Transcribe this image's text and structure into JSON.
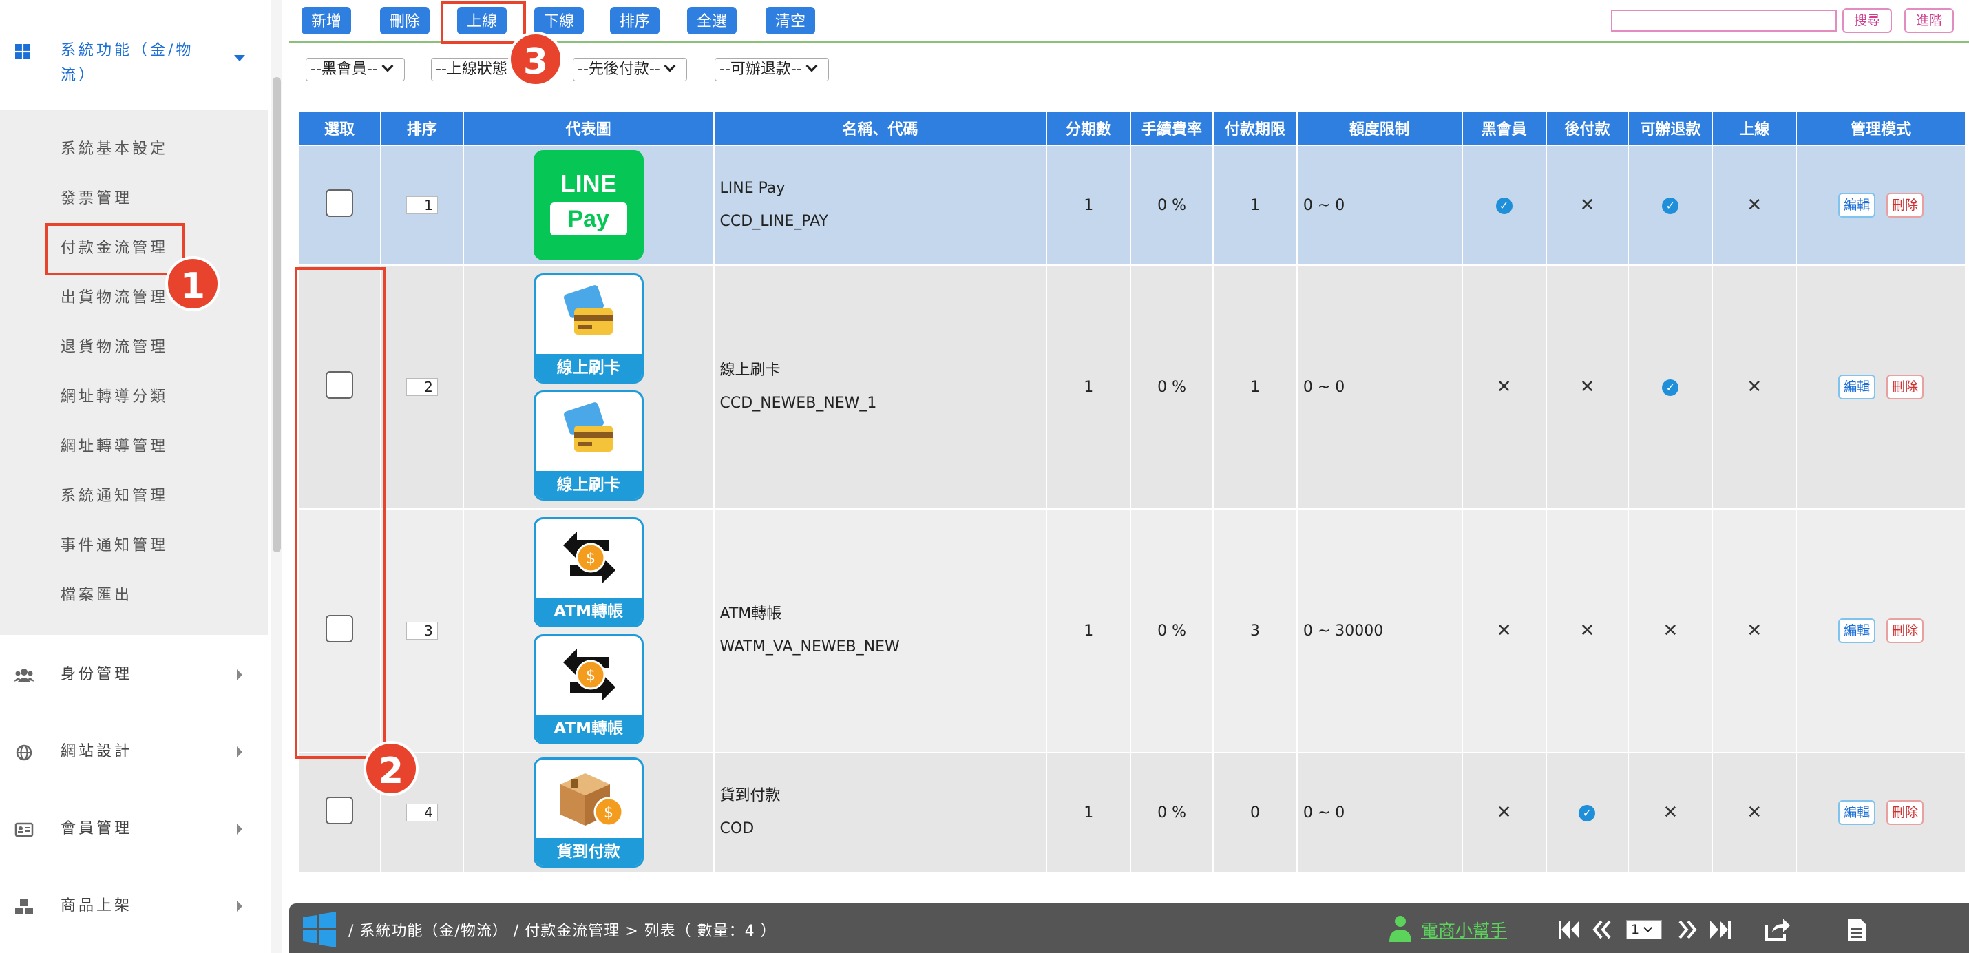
{
  "sidebar": {
    "header": {
      "label": "系統功能（金/物流）"
    },
    "sub_items": [
      "系統基本設定",
      "發票管理",
      "付款金流管理",
      "出貨物流管理",
      "退貨物流管理",
      "網址轉導分類",
      "網址轉導管理",
      "系統通知管理",
      "事件通知管理",
      "檔案匯出"
    ],
    "main_items": [
      {
        "label": "身份管理",
        "icon": "users-icon"
      },
      {
        "label": "網站設計",
        "icon": "globe-icon"
      },
      {
        "label": "會員管理",
        "icon": "id-card-icon"
      },
      {
        "label": "商品上架",
        "icon": "boxes-icon"
      }
    ]
  },
  "toolbar": {
    "add": "新增",
    "delete": "刪除",
    "online": "上線",
    "offline": "下線",
    "sort": "排序",
    "select_all": "全選",
    "clear": "清空",
    "search": "搜尋",
    "advanced": "進階"
  },
  "filters": [
    "--黑會員--",
    "--上線狀態",
    "--先後付款--",
    "--可辦退款--"
  ],
  "table": {
    "headers": [
      "選取",
      "排序",
      "代表圖",
      "名稱、代碼",
      "分期數",
      "手續費率",
      "付款期限",
      "額度限制",
      "黑會員",
      "後付款",
      "可辦退款",
      "上線",
      "管理模式"
    ],
    "rows": [
      {
        "sort": "1",
        "name": "LINE Pay",
        "code": "CCD_LINE_PAY",
        "installments": "1",
        "fee": "0 %",
        "deadline": "1",
        "limit": "0 ~ 0",
        "blacklist": true,
        "postpay": false,
        "refund": true,
        "online": false,
        "logos": [
          {
            "type": "line",
            "line_text": "LINE",
            "pay_text": "Pay"
          }
        ]
      },
      {
        "sort": "2",
        "name": "線上刷卡",
        "code": "CCD_NEWEB_NEW_1",
        "installments": "1",
        "fee": "0 %",
        "deadline": "1",
        "limit": "0 ~ 0",
        "blacklist": false,
        "postpay": false,
        "refund": true,
        "online": false,
        "logos": [
          {
            "type": "card",
            "caption": "線上刷卡"
          },
          {
            "type": "card",
            "caption": "線上刷卡"
          }
        ]
      },
      {
        "sort": "3",
        "name": "ATM轉帳",
        "code": "WATM_VA_NEWEB_NEW",
        "installments": "1",
        "fee": "0 %",
        "deadline": "3",
        "limit": "0 ~ 30000",
        "blacklist": false,
        "postpay": false,
        "refund": false,
        "online": false,
        "logos": [
          {
            "type": "atm",
            "caption": "ATM轉帳"
          },
          {
            "type": "atm",
            "caption": "ATM轉帳"
          }
        ]
      },
      {
        "sort": "4",
        "name": "貨到付款",
        "code": "COD",
        "installments": "1",
        "fee": "0 %",
        "deadline": "0",
        "limit": "0 ~ 0",
        "blacklist": false,
        "postpay": true,
        "refund": false,
        "online": false,
        "logos": [
          {
            "type": "cod",
            "caption": "貨到付款"
          }
        ]
      }
    ],
    "edit": "編輯",
    "remove": "刪除"
  },
  "footer": {
    "breadcrumb": "/  系統功能（金/物流）  /  付款金流管理  >  列表（ 數量：4 ）",
    "helper": "電商小幫手",
    "page": "1"
  },
  "annotations": {
    "one": "1",
    "two": "2",
    "three": "3"
  },
  "colors": {
    "primary": "#2f7fe0",
    "accent_red": "#e8432d",
    "line_green": "#06c755",
    "check_blue": "#1e8fd8"
  }
}
